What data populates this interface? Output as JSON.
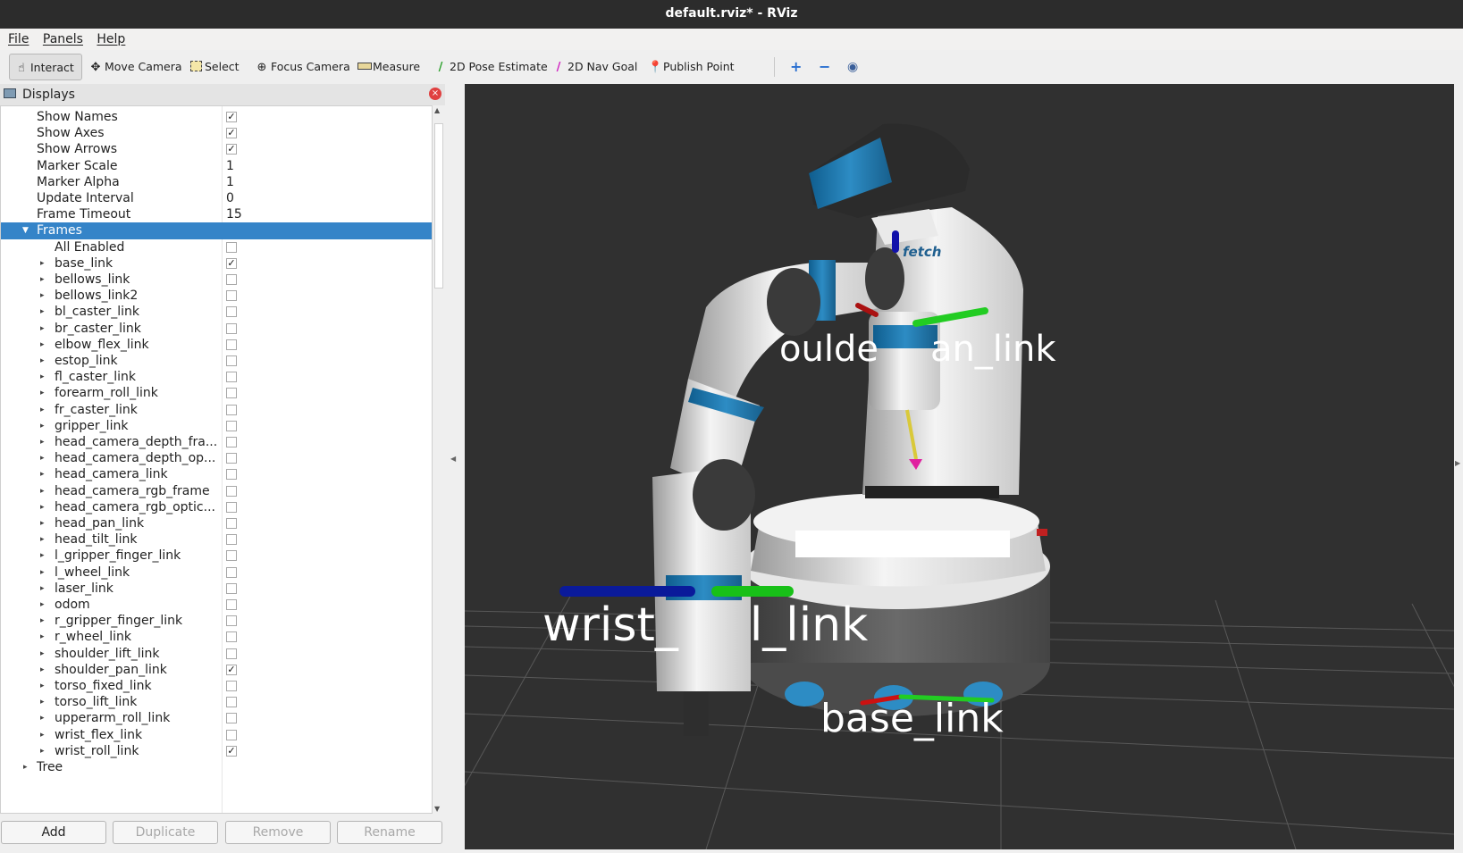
{
  "window": {
    "title": "default.rviz* - RViz"
  },
  "menu": [
    "File",
    "Panels",
    "Help"
  ],
  "toolbar": {
    "tools": [
      {
        "label": "Interact",
        "icon": "hand-pointer-icon"
      },
      {
        "label": "Move Camera",
        "icon": "move-camera-icon"
      },
      {
        "label": "Select",
        "icon": "select-rect-icon"
      },
      {
        "label": "Focus Camera",
        "icon": "focus-camera-icon"
      },
      {
        "label": "Measure",
        "icon": "ruler-icon"
      },
      {
        "label": "2D Pose Estimate",
        "icon": "pose-arrow-green-icon"
      },
      {
        "label": "2D Nav Goal",
        "icon": "goal-arrow-pink-icon"
      },
      {
        "label": "Publish Point",
        "icon": "map-pin-icon"
      }
    ],
    "extra_icons": [
      "add-tool-icon",
      "remove-tool-icon",
      "view-eye-icon"
    ]
  },
  "displays": {
    "title": "Displays",
    "properties": [
      {
        "label": "Show Names",
        "checked": true
      },
      {
        "label": "Show Axes",
        "checked": true
      },
      {
        "label": "Show Arrows",
        "checked": true
      },
      {
        "label": "Marker Scale",
        "value": "1"
      },
      {
        "label": "Marker Alpha",
        "value": "1"
      },
      {
        "label": "Update Interval",
        "value": "0"
      },
      {
        "label": "Frame Timeout",
        "value": "15"
      }
    ],
    "frames_label": "Frames",
    "all_enabled_label": "All Enabled",
    "all_enabled_checked": false,
    "frames": [
      {
        "name": "base_link",
        "checked": true
      },
      {
        "name": "bellows_link",
        "checked": false
      },
      {
        "name": "bellows_link2",
        "checked": false
      },
      {
        "name": "bl_caster_link",
        "checked": false
      },
      {
        "name": "br_caster_link",
        "checked": false
      },
      {
        "name": "elbow_flex_link",
        "checked": false
      },
      {
        "name": "estop_link",
        "checked": false
      },
      {
        "name": "fl_caster_link",
        "checked": false
      },
      {
        "name": "forearm_roll_link",
        "checked": false
      },
      {
        "name": "fr_caster_link",
        "checked": false
      },
      {
        "name": "gripper_link",
        "checked": false
      },
      {
        "name": "head_camera_depth_fra...",
        "checked": false
      },
      {
        "name": "head_camera_depth_op...",
        "checked": false
      },
      {
        "name": "head_camera_link",
        "checked": false
      },
      {
        "name": "head_camera_rgb_frame",
        "checked": false
      },
      {
        "name": "head_camera_rgb_optic...",
        "checked": false
      },
      {
        "name": "head_pan_link",
        "checked": false
      },
      {
        "name": "head_tilt_link",
        "checked": false
      },
      {
        "name": "l_gripper_finger_link",
        "checked": false
      },
      {
        "name": "l_wheel_link",
        "checked": false
      },
      {
        "name": "laser_link",
        "checked": false
      },
      {
        "name": "odom",
        "checked": false
      },
      {
        "name": "r_gripper_finger_link",
        "checked": false
      },
      {
        "name": "r_wheel_link",
        "checked": false
      },
      {
        "name": "shoulder_lift_link",
        "checked": false
      },
      {
        "name": "shoulder_pan_link",
        "checked": true
      },
      {
        "name": "torso_fixed_link",
        "checked": false
      },
      {
        "name": "torso_lift_link",
        "checked": false
      },
      {
        "name": "upperarm_roll_link",
        "checked": false
      },
      {
        "name": "wrist_flex_link",
        "checked": false
      },
      {
        "name": "wrist_roll_link",
        "checked": true
      }
    ],
    "tree_label": "Tree",
    "buttons": [
      {
        "label": "Add",
        "enabled": true
      },
      {
        "label": "Duplicate",
        "enabled": false
      },
      {
        "label": "Remove",
        "enabled": false
      },
      {
        "label": "Rename",
        "enabled": false
      }
    ]
  },
  "viewport": {
    "frame_labels": [
      "houlder_pan_link",
      "wrist_roll_link",
      "base_link"
    ],
    "label_wrist_parts": [
      "wrist_",
      "l_link"
    ],
    "label_shoulder_parts": [
      "oulde",
      "an_link"
    ]
  },
  "colors": {
    "selection": "#3584c8",
    "viewport_bg": "#303030",
    "fetch_blue": "#1f78b4"
  }
}
